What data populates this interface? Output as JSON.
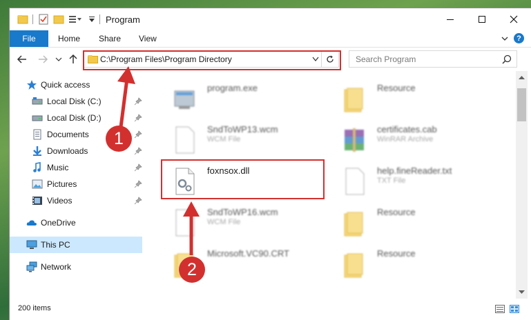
{
  "window": {
    "title": "Program"
  },
  "ribbon": {
    "tabs": [
      "File",
      "Home",
      "Share",
      "View"
    ],
    "help": "?"
  },
  "nav": {
    "address": "C:\\Program Files\\Program Directory",
    "search_placeholder": "Search Program"
  },
  "sidebar": {
    "items": [
      {
        "label": "Quick access",
        "icon": "star-icon"
      },
      {
        "label": "Local Disk (C:)",
        "icon": "drive-icon",
        "pinned": true
      },
      {
        "label": "Local Disk (D:)",
        "icon": "drive-icon",
        "pinned": true
      },
      {
        "label": "Documents",
        "icon": "documents-icon",
        "pinned": true
      },
      {
        "label": "Downloads",
        "icon": "download-icon",
        "pinned": true
      },
      {
        "label": "Music",
        "icon": "music-icon",
        "pinned": true
      },
      {
        "label": "Pictures",
        "icon": "pictures-icon",
        "pinned": true
      },
      {
        "label": "Videos",
        "icon": "videos-icon",
        "pinned": true
      },
      {
        "label": "OneDrive",
        "icon": "cloud-icon"
      },
      {
        "label": "This PC",
        "icon": "computer-icon",
        "selected": true
      },
      {
        "label": "Network",
        "icon": "network-icon"
      }
    ]
  },
  "files": [
    {
      "name": "program.exe",
      "type": "",
      "icon": "exe-icon"
    },
    {
      "name": "Resource",
      "type": "",
      "icon": "folder-icon"
    },
    {
      "name": "SndToWP13.wcm",
      "type": "WCM File",
      "icon": "blank-file-icon"
    },
    {
      "name": "certificates.cab",
      "type": "WinRAR Archive",
      "icon": "winrar-icon"
    },
    {
      "name": "foxnsox.dll",
      "type": "",
      "icon": "dll-file-icon"
    },
    {
      "name": "help.fineReader.txt",
      "type": "TXT File",
      "icon": "blank-file-icon"
    },
    {
      "name": "SndToWP16.wcm",
      "type": "WCM File",
      "icon": "blank-file-icon"
    },
    {
      "name": "Resource",
      "type": "",
      "icon": "folder-icon"
    },
    {
      "name": "Microsoft.VC90.CRT",
      "type": "",
      "icon": "folder-icon"
    },
    {
      "name": "Resource",
      "type": "",
      "icon": "folder-icon"
    }
  ],
  "status": {
    "count": "200 items"
  },
  "annotations": {
    "step1": "1",
    "step2": "2",
    "color": "#d2302f"
  },
  "colors": {
    "accent": "#1979ca",
    "selection": "#cce8ff"
  }
}
